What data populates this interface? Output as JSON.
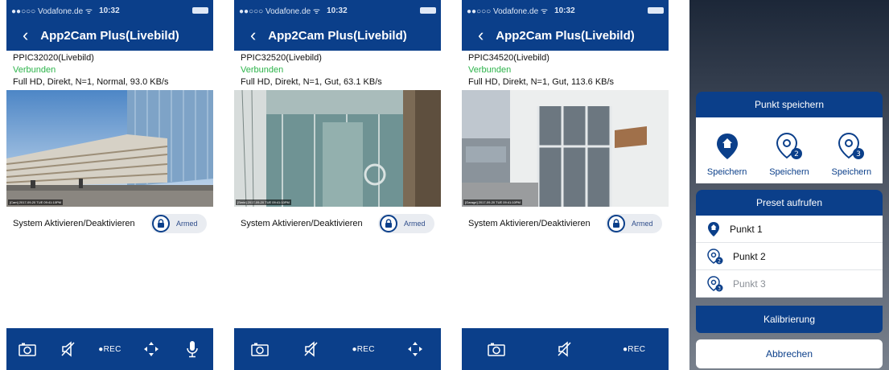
{
  "statusbar": {
    "carrier": "●●○○○ Vodafone.de ᯤ",
    "time": "10:32"
  },
  "app_title": "App2Cam Plus(Livebild)",
  "arm_label": "System Aktivieren/Deaktivieren",
  "arm_state": "Armed",
  "rec_label": "●REC",
  "cameras": [
    {
      "name": "PPIC32020(Livebild)",
      "status": "Verbunden",
      "stream": "Full HD, Direkt, N=1, Normal, 93.0 KB/s",
      "timestamp": "[Cam] 2017-09-20 TUE 09:41:10PM"
    },
    {
      "name": "PPIC32520(Livebild)",
      "status": "Verbunden",
      "stream": "Full HD, Direkt, N=1, Gut, 63.1 KB/s",
      "timestamp": "[Serie] 2017-09-20 TUE 09:41:10PM"
    },
    {
      "name": "PPIC34520(Livebild)",
      "status": "Verbunden",
      "stream": "Full HD, Direkt, N=1, Gut, 113.6 KB/s",
      "timestamp": "[Garage] 2017-09-20 TUE 09:41:10PM"
    }
  ],
  "preset_panel": {
    "save_title": "Punkt speichern",
    "save_buttons": [
      "Speichern",
      "Speichern",
      "Speichern"
    ],
    "recall_title": "Preset aufrufen",
    "presets": [
      "Punkt 1",
      "Punkt 2",
      "Punkt 3"
    ],
    "calibration": "Kalibrierung",
    "cancel": "Abbrechen"
  },
  "colors": {
    "brand": "#0b3f8a",
    "connected": "#2cb34a",
    "background": "#ffffff"
  }
}
